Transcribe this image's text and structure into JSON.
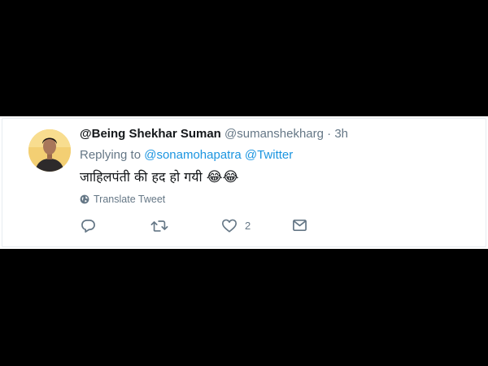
{
  "tweet": {
    "display_name": "@Being Shekhar Suman",
    "handle": "@sumanshekharg",
    "separator": "·",
    "time": "3h",
    "reply_prefix": "Replying to",
    "reply_to": [
      "@sonamohapatra",
      "@Twitter"
    ],
    "text": "जाहिलपंती की हद हो गयी",
    "emoji": "😂😂",
    "translate_label": "Translate Tweet",
    "like_count": "2"
  },
  "icons": {
    "reply": "reply-icon",
    "retweet": "retweet-icon",
    "like": "heart-icon",
    "dm": "envelope-icon",
    "translate": "globe-icon"
  },
  "colors": {
    "link": "#1b95e0",
    "secondary": "#657786",
    "primary_text": "#14171a",
    "background": "#000000"
  }
}
